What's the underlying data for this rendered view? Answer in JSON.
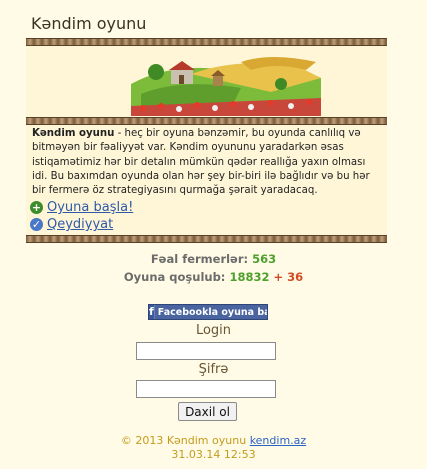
{
  "header": {
    "title": "Kəndim oyunu"
  },
  "description": {
    "game_name": "Kəndim oyunu",
    "text": " - heç bir oyuna bənzəmir, bu oyunda canlılıq və bitməyən bir fəaliyyət var. Kəndim oyununu yaradarkən əsas istiqamətimiz hər bir detalın mümkün qədər reallığa yaxın olması idi. Bu baxımdan oyunda olan hər şey bir-biri ilə bağlıdır və bu hər bir fermerə öz strategiyasını qurmağa şərait yaradacaq."
  },
  "links": {
    "start": "Oyuna başla!",
    "register": "Qeydiyyat"
  },
  "stats": {
    "active_label": "Fəal fermerlər:",
    "active_value": "563",
    "joined_label": "Oyuna qoşulub:",
    "joined_value": "18832",
    "joined_plus": "+ 36"
  },
  "facebook": {
    "label": "Facebookla oyuna başla"
  },
  "login": {
    "login_label": "Login",
    "password_label": "Şifrə",
    "login_value": "",
    "password_value": "",
    "submit_label": "Daxil ol"
  },
  "footer": {
    "copyright": "© 2013 Kəndim oyunu",
    "site_link": "kendim.az",
    "timestamp": "31.03.14 12:53"
  },
  "colors": {
    "accent_green": "#4da02c",
    "accent_red": "#d24a24",
    "link": "#2e5aa8",
    "footer_text": "#c39b1d"
  },
  "icons": {
    "start": "plus-circle-icon",
    "register": "check-circle-icon",
    "facebook": "facebook-icon"
  }
}
